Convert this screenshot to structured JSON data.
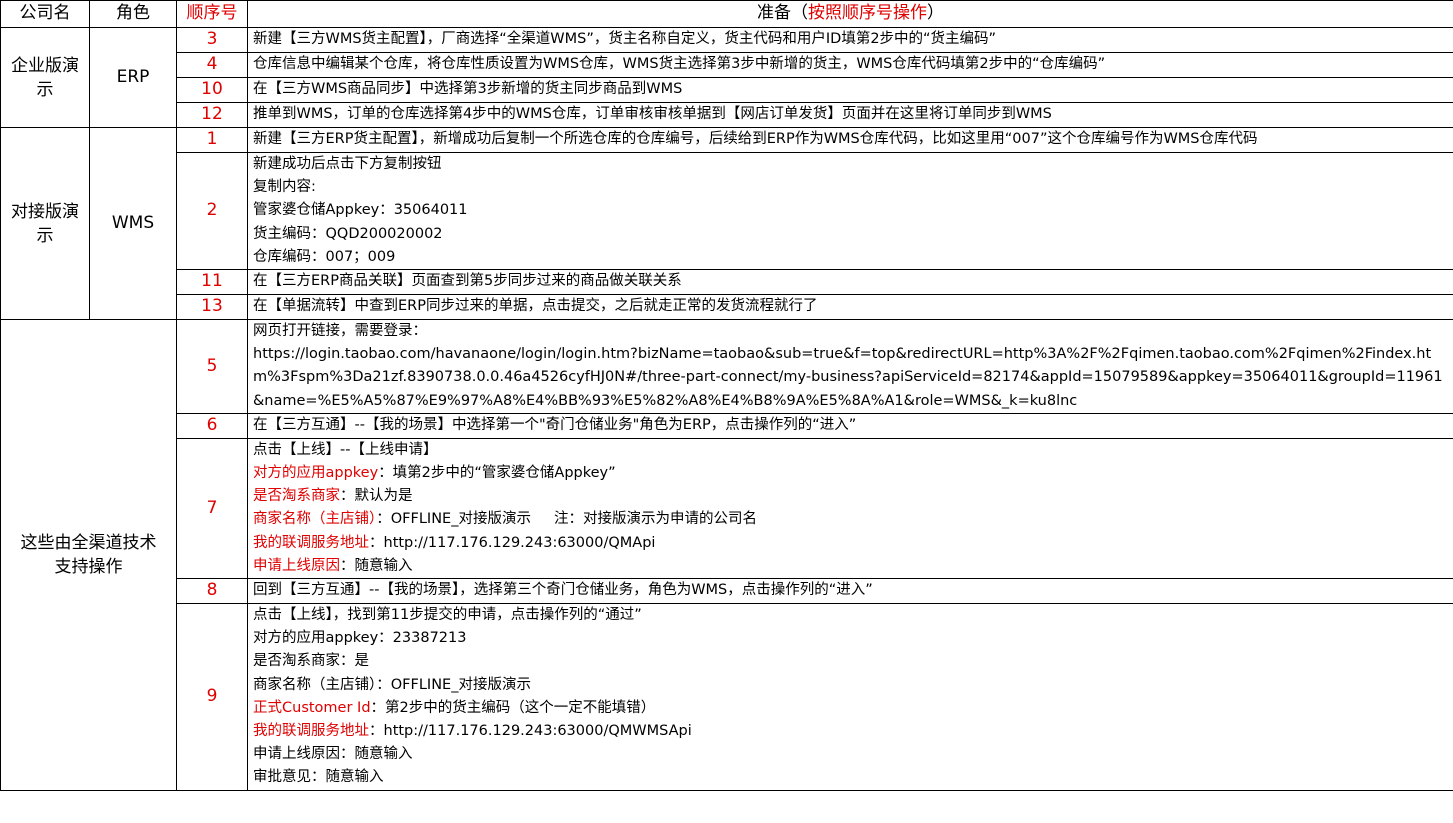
{
  "header": {
    "company": "公司名",
    "role": "角色",
    "step": "顺序号",
    "prep_prefix": "准备（",
    "prep_red": "按照顺序号操作",
    "prep_suffix": "）"
  },
  "groups": [
    {
      "company": "企业版演示",
      "role": "ERP",
      "rows": [
        {
          "step": "3",
          "text": "新建【三方WMS货主配置】，厂商选择“全渠道WMS”，货主名称自定义，货主代码和用户ID填第2步中的“货主编码”"
        },
        {
          "step": "4",
          "text": "仓库信息中编辑某个仓库，将仓库性质设置为WMS仓库，WMS货主选择第3步中新增的货主，WMS仓库代码填第2步中的“仓库编码”"
        },
        {
          "step": "10",
          "text": "在【三方WMS商品同步】中选择第3步新增的货主同步商品到WMS"
        },
        {
          "step": "12",
          "text": "推单到WMS，订单的仓库选择第4步中的WMS仓库，订单审核审核单据到【网店订单发货】页面并在这里将订单同步到WMS"
        }
      ]
    },
    {
      "company": "对接版演示",
      "role": "WMS",
      "rows": [
        {
          "step": "1",
          "text": "新建【三方ERP货主配置】，新增成功后复制一个所选仓库的仓库编号，后续给到ERP作为WMS仓库代码，比如这里用“007”这个仓库编号作为WMS仓库代码"
        },
        {
          "step": "2",
          "lines": [
            "新建成功后点击下方复制按钮",
            "复制内容:",
            "管家婆仓储Appkey：35064011",
            "货主编码：QQD200020002",
            "仓库编码：007；009"
          ]
        },
        {
          "step": "11",
          "text": "在【三方ERP商品关联】页面查到第5步同步过来的商品做关联关系"
        },
        {
          "step": "13",
          "text": "在【单据流转】中查到ERP同步过来的单据，点击提交，之后就走正常的发货流程就行了"
        }
      ]
    }
  ],
  "support": {
    "company_line1": "这些由全渠道技术",
    "company_line2": "支持操作",
    "rows": {
      "s5": {
        "step": "5",
        "intro": "网页打开链接，需要登录：",
        "url": "https://login.taobao.com/havanaone/login/login.htm?bizName=taobao&sub=true&f=top&redirectURL=http%3A%2F%2Fqimen.taobao.com%2Fqimen%2Findex.htm%3Fspm%3Da21zf.8390738.0.0.46a4526cyfHJ0N#/three-part-connect/my-business?apiServiceId=82174&appId=15079589&appkey=35064011&groupId=11961&name=%E5%A5%87%E9%97%A8%E4%BB%93%E5%82%A8%E4%B8%9A%E5%8A%A1&role=WMS&_k=ku8lnc"
      },
      "s6": {
        "step": "6",
        "text": "在【三方互通】--【我的场景】中选择第一个\"奇门仓储业务\"角色为ERP，点击操作列的“进入”"
      },
      "s7": {
        "step": "7",
        "l1": "点击【上线】--【上线申请】",
        "l2_label": "对方的应用appkey",
        "l2_value": "：填第2步中的“管家婆仓储Appkey”",
        "l3_label": "是否淘系商家",
        "l3_value": "：默认为是",
        "l4_label": "商家名称（主店铺）",
        "l4_value": "：OFFLINE_对接版演示     注：对接版演示为申请的公司名",
        "l5_label": "我的联调服务地址",
        "l5_value": "：http://117.176.129.243:63000/QMApi",
        "l6_label": "申请上线原因",
        "l6_value": "：随意输入"
      },
      "s8": {
        "step": "8",
        "text": "回到【三方互通】--【我的场景】，选择第三个奇门仓储业务，角色为WMS，点击操作列的“进入”"
      },
      "s9": {
        "step": "9",
        "l1": "点击【上线】，找到第11步提交的申请，点击操作列的“通过”",
        "l2": "对方的应用appkey：23387213",
        "l3": "是否淘系商家：是",
        "l4": "商家名称（主店铺）：OFFLINE_对接版演示",
        "l5_label": "正式Customer Id",
        "l5_value": "：第2步中的货主编码（这个一定不能填错）",
        "l6_label": "我的联调服务地址",
        "l6_value": "：http://117.176.129.243:63000/QMWMSApi",
        "l7": "申请上线原因：随意输入",
        "l8": "审批意见：随意输入"
      }
    }
  }
}
